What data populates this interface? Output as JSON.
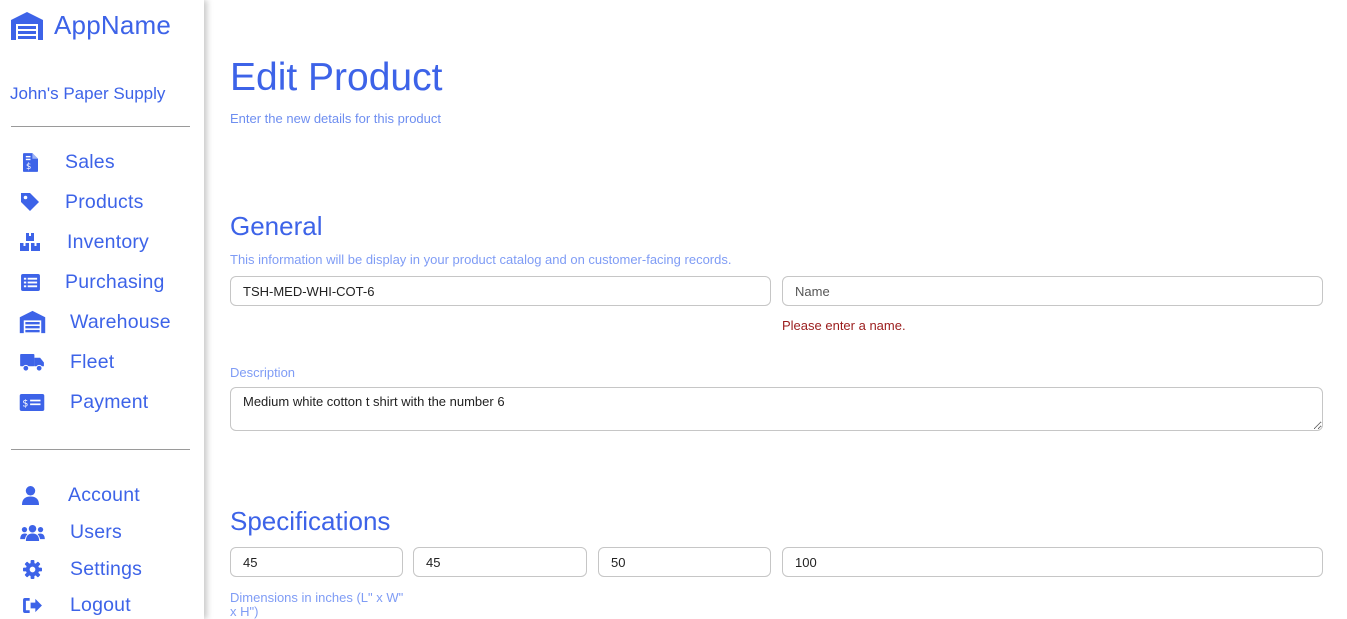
{
  "sidebar": {
    "app_name": "AppName",
    "company": "John's Paper Supply",
    "nav": [
      {
        "label": "Sales",
        "icon": "file-invoice-dollar-icon"
      },
      {
        "label": "Products",
        "icon": "tag-icon"
      },
      {
        "label": "Inventory",
        "icon": "boxes-icon"
      },
      {
        "label": "Purchasing",
        "icon": "list-alt-icon"
      },
      {
        "label": "Warehouse",
        "icon": "warehouse-icon"
      },
      {
        "label": "Fleet",
        "icon": "truck-icon"
      },
      {
        "label": "Payment",
        "icon": "money-check-icon"
      }
    ],
    "account_nav": [
      {
        "label": "Account",
        "icon": "user-icon"
      },
      {
        "label": "Users",
        "icon": "users-icon"
      },
      {
        "label": "Settings",
        "icon": "gear-icon"
      },
      {
        "label": "Logout",
        "icon": "sign-out-icon"
      }
    ]
  },
  "page": {
    "title": "Edit Product",
    "subtitle": "Enter the new details for this product"
  },
  "general": {
    "title": "General",
    "help": "This information will be display in your product catalog and on customer-facing records.",
    "sku_value": "TSH-MED-WHI-COT-6",
    "name_value": "",
    "name_placeholder": "Name",
    "name_error": "Please enter a name.",
    "description_label": "Description",
    "description_value": "Medium white cotton t shirt with the number 6"
  },
  "specifications": {
    "title": "Specifications",
    "length_value": "45",
    "width_value": "45",
    "height_value": "50",
    "weight_value": "100",
    "dimensions_hint": "Dimensions in inches (L\" x W\" x H\")"
  },
  "colors": {
    "accent": "#3d63e8",
    "help_text": "#7f9cf5",
    "error": "#9b1c1c"
  }
}
